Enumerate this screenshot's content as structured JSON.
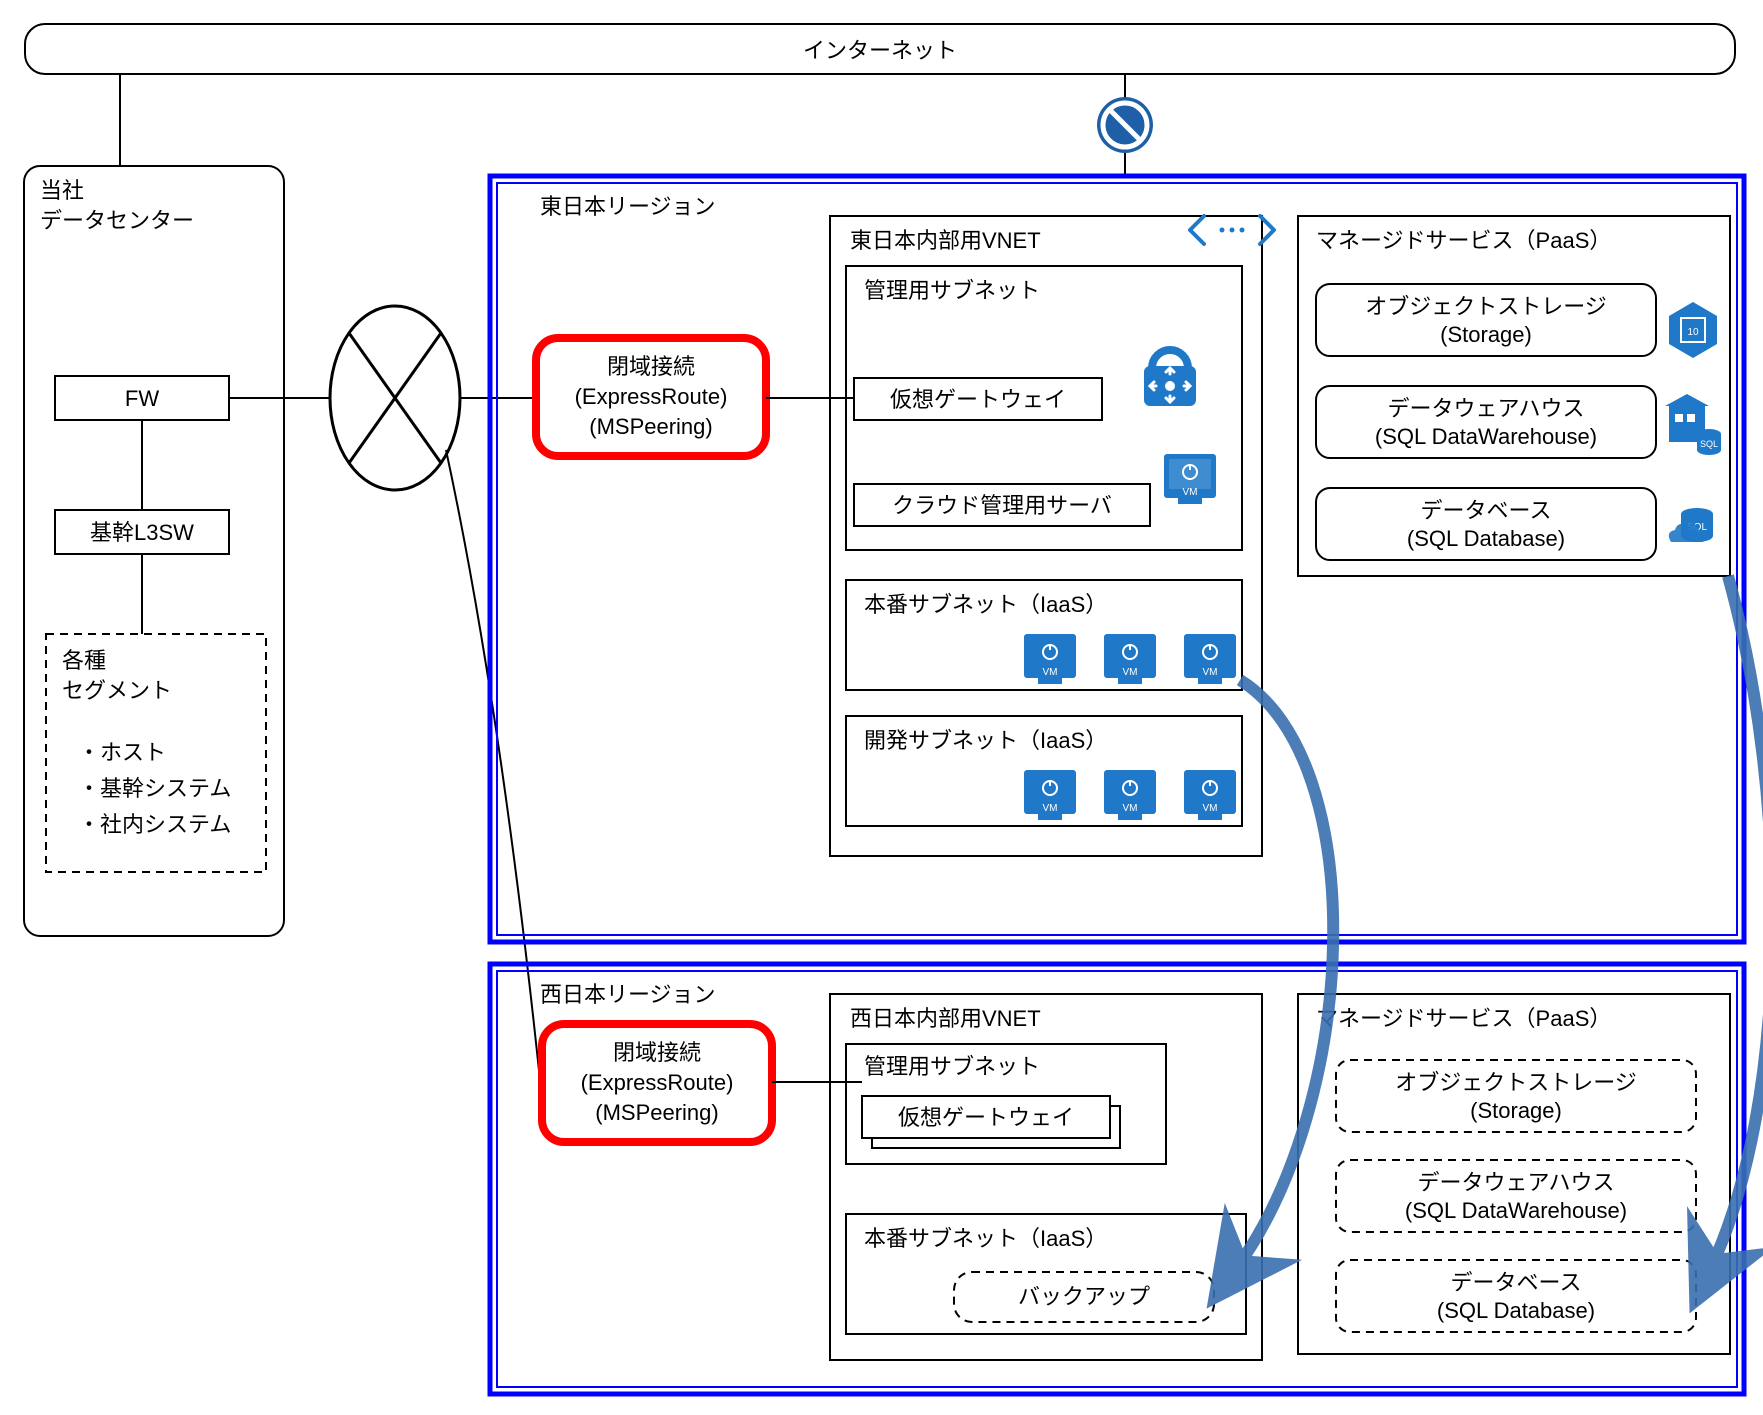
{
  "internet": "インターネット",
  "datacenter": {
    "title1": "当社",
    "title2": "データセンター",
    "fw": "FW",
    "l3sw": "基幹L3SW",
    "segments_title1": "各種",
    "segments_title2": "セグメント",
    "seg_item1": "・ホスト",
    "seg_item2": "・基幹システム",
    "seg_item3": "・社内システム"
  },
  "east": {
    "region": "東日本リージョン",
    "er1": "閉域接続",
    "er2": "(ExpressRoute)",
    "er3": "(MSPeering)",
    "vnet": "東日本内部用VNET",
    "mgmt_subnet": "管理用サブネット",
    "vgw": "仮想ゲートウェイ",
    "cloud_mgmt": "クラウド管理用サーバ",
    "prod_subnet": "本番サブネット（IaaS）",
    "dev_subnet": "開発サブネット（IaaS）",
    "paas_title": "マネージドサービス（PaaS）",
    "storage1": "オブジェクトストレージ",
    "storage2": "(Storage)",
    "dw1": "データウェアハウス",
    "dw2": "(SQL DataWarehouse)",
    "db1": "データベース",
    "db2": "(SQL Database)"
  },
  "west": {
    "region": "西日本リージョン",
    "er1": "閉域接続",
    "er2": "(ExpressRoute)",
    "er3": "(MSPeering)",
    "vnet": "西日本内部用VNET",
    "mgmt_subnet": "管理用サブネット",
    "vgw": "仮想ゲートウェイ",
    "prod_subnet": "本番サブネット（IaaS）",
    "backup": "バックアップ",
    "paas_title": "マネージドサービス（PaaS）",
    "storage1": "オブジェクトストレージ",
    "storage2": "(Storage)",
    "dw1": "データウェアハウス",
    "dw2": "(SQL DataWarehouse)",
    "db1": "データベース",
    "db2": "(SQL Database)"
  },
  "vm_label": "VM"
}
